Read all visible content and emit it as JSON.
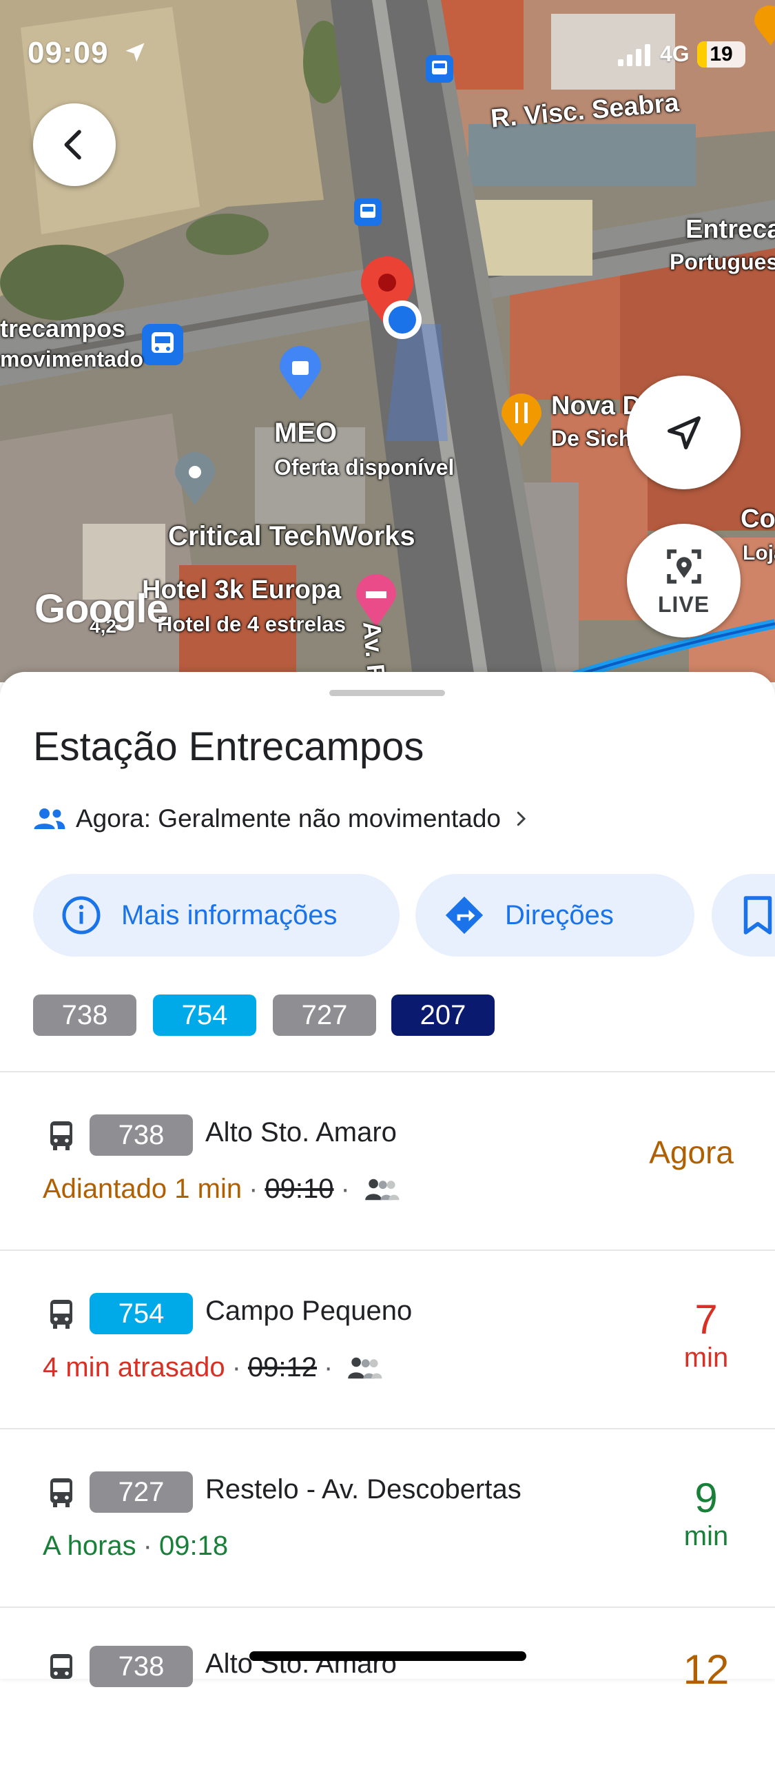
{
  "status_bar": {
    "time": "09:09",
    "network": "4G",
    "battery": "19"
  },
  "map": {
    "labels": {
      "street_seabra": "R. Visc. Seabra",
      "entrecampos_right": "Entreca",
      "portugues": "Portugues",
      "entrecampos_left": "trecampos",
      "movimentado": "movimentado",
      "nova": "Nova D",
      "de_sich": "De Sich",
      "meo": "MEO",
      "meo_offer": "Oferta disponível",
      "critical": "Critical TechWorks",
      "hotel": "Hotel 3k Europa",
      "hotel_sub": "Hotel de 4 estrelas",
      "hotel_rating": "4,2",
      "avenue": "Av. Rep",
      "co": "Co",
      "loja": "Loja d"
    },
    "logo": "Google",
    "live_label": "LIVE"
  },
  "sheet": {
    "title": "Estação Entrecampos",
    "busyness": "Agora: Geralmente não movimentado",
    "actions": {
      "info": "Mais informações",
      "directions": "Direções"
    },
    "routes": [
      {
        "label": "738",
        "color": "#8e8e93"
      },
      {
        "label": "754",
        "color": "#00a9e8"
      },
      {
        "label": "727",
        "color": "#8e8e93"
      },
      {
        "label": "207",
        "color": "#0a1a6e"
      }
    ],
    "departures": [
      {
        "route": "738",
        "route_color": "#8e8e93",
        "destination": "Alto Sto. Amaro",
        "status": "Adiantado 1 min",
        "status_color": "#b06000",
        "scheduled": "09:10",
        "eta": "Agora",
        "eta_color": "#b06000"
      },
      {
        "route": "754",
        "route_color": "#00a9e8",
        "destination": "Campo Pequeno",
        "status": "4 min atrasado",
        "status_color": "#d93025",
        "scheduled": "09:12",
        "eta_number": "7",
        "eta_unit": "min",
        "eta_color": "#d93025"
      },
      {
        "route": "727",
        "route_color": "#8e8e93",
        "destination": "Restelo - Av. Descobertas",
        "status": "A horas",
        "status_color": "#188038",
        "time": "09:18",
        "eta_number": "9",
        "eta_unit": "min",
        "eta_color": "#188038"
      },
      {
        "route": "738",
        "route_color": "#8e8e93",
        "destination": "Alto Sto. Amaro",
        "eta_number": "12",
        "eta_color": "#b06000"
      }
    ]
  }
}
